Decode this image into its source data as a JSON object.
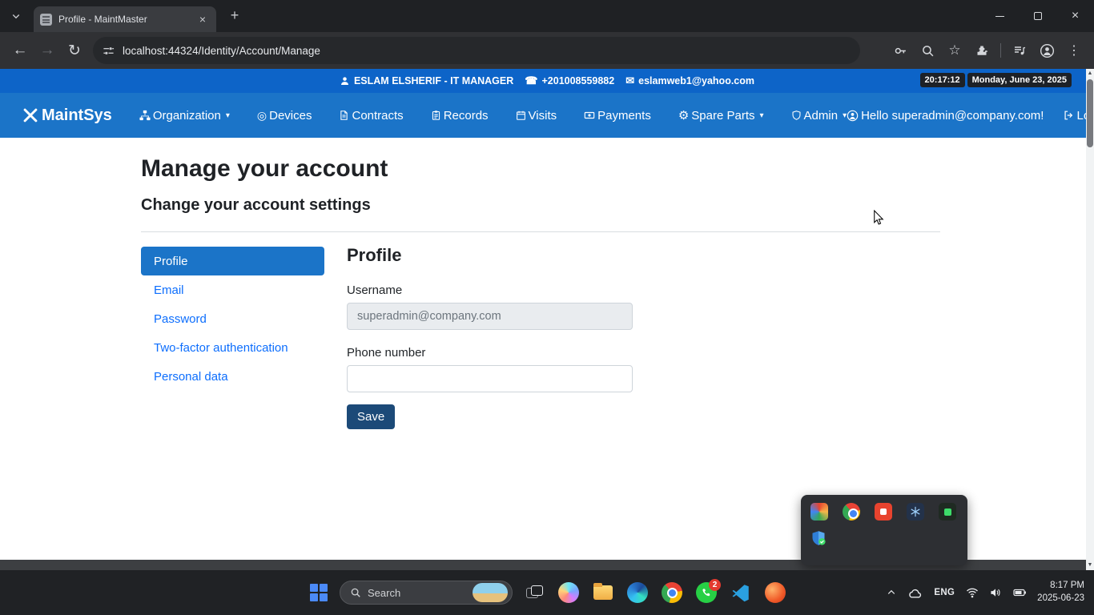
{
  "browser": {
    "tab_title": "Profile - MaintMaster",
    "url": "localhost:44324/Identity/Account/Manage"
  },
  "topbar": {
    "user": "ESLAM ELSHERIF - IT MANAGER",
    "phone": "+201008559882",
    "email": "eslamweb1@yahoo.com",
    "time": "20:17:12",
    "date": "Monday, June 23, 2025"
  },
  "navbar": {
    "brand": "MaintSys",
    "items": [
      {
        "label": "Organization",
        "caret": true
      },
      {
        "label": "Devices"
      },
      {
        "label": "Contracts"
      },
      {
        "label": "Records"
      },
      {
        "label": "Visits"
      },
      {
        "label": "Payments"
      },
      {
        "label": "Spare Parts",
        "caret": true
      },
      {
        "label": "Admin",
        "caret": true
      }
    ],
    "greeting": "Hello superadmin@company.com!",
    "logout": "Logout"
  },
  "main": {
    "title": "Manage your account",
    "subtitle": "Change your account settings",
    "side_nav": [
      {
        "label": "Profile",
        "active": true
      },
      {
        "label": "Email"
      },
      {
        "label": "Password"
      },
      {
        "label": "Two-factor authentication"
      },
      {
        "label": "Personal data"
      }
    ],
    "section_title": "Profile",
    "form": {
      "username_label": "Username",
      "username_value": "superadmin@company.com",
      "phone_label": "Phone number",
      "phone_value": "",
      "save_label": "Save"
    }
  },
  "taskbar": {
    "search_label": "Search",
    "whatsapp_badge": "2",
    "lang": "ENG",
    "time": "8:17 PM",
    "date": "2025-06-23"
  },
  "colors": {
    "accent_link": "#0d6efd",
    "navbar_blue": "#1b74c8",
    "topbar_blue": "#0d64c8",
    "active_pill": "#1b74c8",
    "save_button": "#1c4a78",
    "whatsapp_green": "#27d045",
    "badge_red": "#e33a2f"
  }
}
